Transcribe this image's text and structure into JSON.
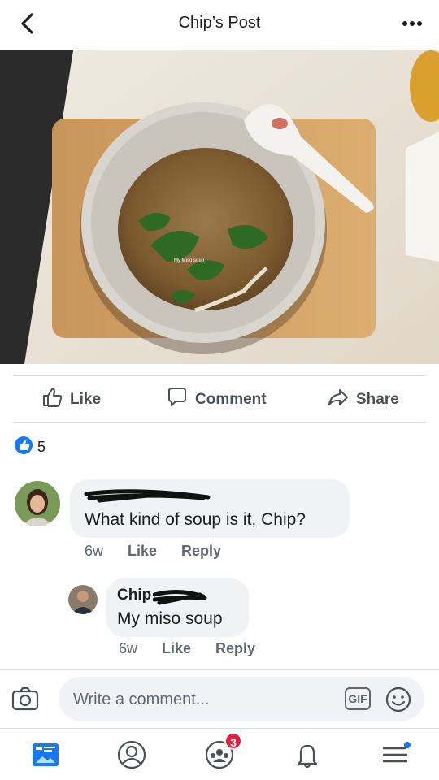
{
  "header": {
    "title": "Chip’s Post",
    "back_icon": "back-chevron-icon",
    "more_icon": "more-dots-icon"
  },
  "photo": {
    "caption": "My Miso soup"
  },
  "actions": {
    "like_label": "Like",
    "comment_label": "Comment",
    "share_label": "Share"
  },
  "reactions": {
    "icon": "like-reaction-icon",
    "count": "5",
    "color": "#1877f2"
  },
  "comments": [
    {
      "text": "What kind of soup is it,  Chip?",
      "time": "6w",
      "like_label": "Like",
      "reply_label": "Reply"
    },
    {
      "author": "Chip",
      "text": "My miso soup",
      "time": "6w",
      "like_label": "Like",
      "reply_label": "Reply"
    }
  ],
  "composer": {
    "placeholder": "Write a comment...",
    "gif_label": "GIF"
  },
  "nav": {
    "groups_badge": "3"
  },
  "colors": {
    "accent": "#1877f2",
    "badge": "#e41e3f",
    "bubble": "#f0f2f5"
  }
}
